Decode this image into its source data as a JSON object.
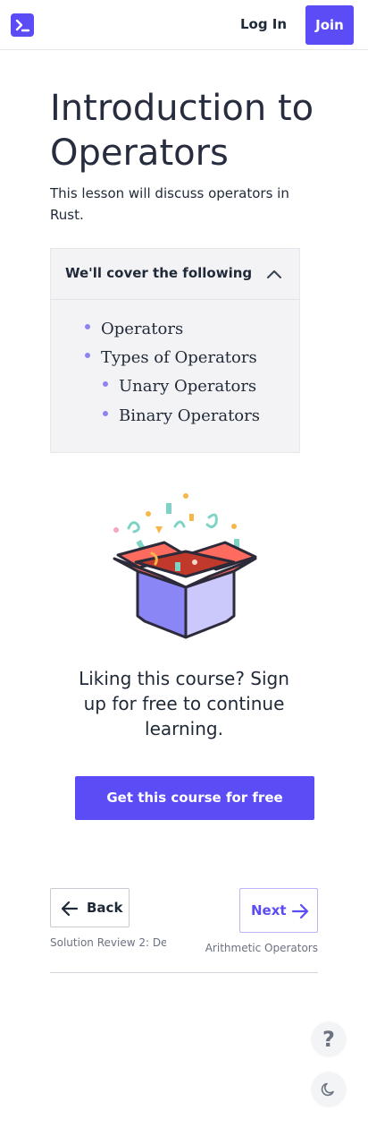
{
  "header": {
    "logo_icon": "terminal-icon",
    "login_label": "Log In",
    "join_label": "Join"
  },
  "lesson": {
    "title": "Introduction to Operators",
    "description": "This lesson will discuss operators in Rust."
  },
  "toc": {
    "heading": "We'll cover the following",
    "items": [
      {
        "label": "Operators",
        "level": 1
      },
      {
        "label": "Types of Operators",
        "level": 1
      },
      {
        "label": "Unary Operators",
        "level": 2
      },
      {
        "label": "Binary Operators",
        "level": 2
      }
    ]
  },
  "promo": {
    "text": "Liking this course? Sign up for free to continue learning.",
    "cta_label": "Get this course for free"
  },
  "nav": {
    "back_label": "Back",
    "back_sub": "Solution Review 2: De...",
    "next_label": "Next",
    "next_sub": "Arithmetic Operators"
  },
  "floating": {
    "help_label": "?",
    "theme_icon": "moon-icon"
  },
  "colors": {
    "accent": "#5b4cf5",
    "bullet": "#8d84f2"
  }
}
